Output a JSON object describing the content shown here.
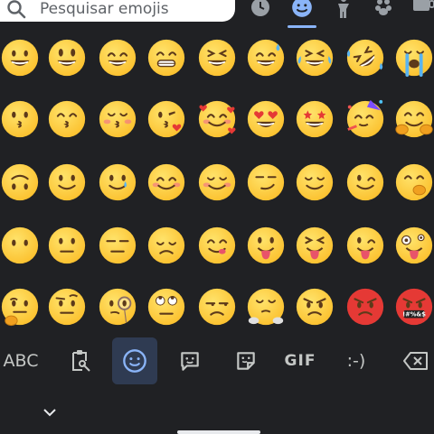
{
  "search": {
    "placeholder": "Pesquisar emojis"
  },
  "categories": [
    {
      "name": "recent-icon",
      "selected": false
    },
    {
      "name": "smileys-icon",
      "selected": true
    },
    {
      "name": "person-icon",
      "selected": false
    },
    {
      "name": "nature-icon",
      "selected": false
    },
    {
      "name": "food-icon",
      "selected": false
    }
  ],
  "emojis": [
    [
      "grinning",
      "smiley",
      "smile",
      "grin",
      "laughing",
      "sweat-smile",
      "joy",
      "rofl",
      "sob"
    ],
    [
      "kissing",
      "kissing-smiling-eyes",
      "kissing-closed-eyes",
      "kissing-heart",
      "smiling-hearts",
      "heart-eyes",
      "star-struck",
      "partying",
      "hugging"
    ],
    [
      "upside-down",
      "slightly-smiling",
      "smiling-tear",
      "blush",
      "relaxed",
      "smirk",
      "relieved",
      "wink",
      "hand-over-mouth"
    ],
    [
      "no-mouth",
      "neutral",
      "expressionless",
      "pensive",
      "yum",
      "tongue",
      "squinting-tongue",
      "winking-tongue",
      "zany"
    ],
    [
      "thinking",
      "raised-eyebrow",
      "monocle",
      "rolling-eyes",
      "unamused",
      "steam-nose",
      "angry",
      "pouting",
      "cursing"
    ]
  ],
  "toolbar": {
    "abc_label": "ABC",
    "gif_label": "GIF",
    "emoticon_label": ":-)",
    "icons": [
      "clipboard-icon",
      "emoji-icon",
      "emoji-kitchen-icon",
      "sticker-icon",
      "backspace-icon"
    ]
  },
  "colors": {
    "background": "#202124",
    "accent": "#8ab4f8",
    "emoji_yellow": "#fbc02d"
  },
  "cursing_symbols": "!#%&$"
}
